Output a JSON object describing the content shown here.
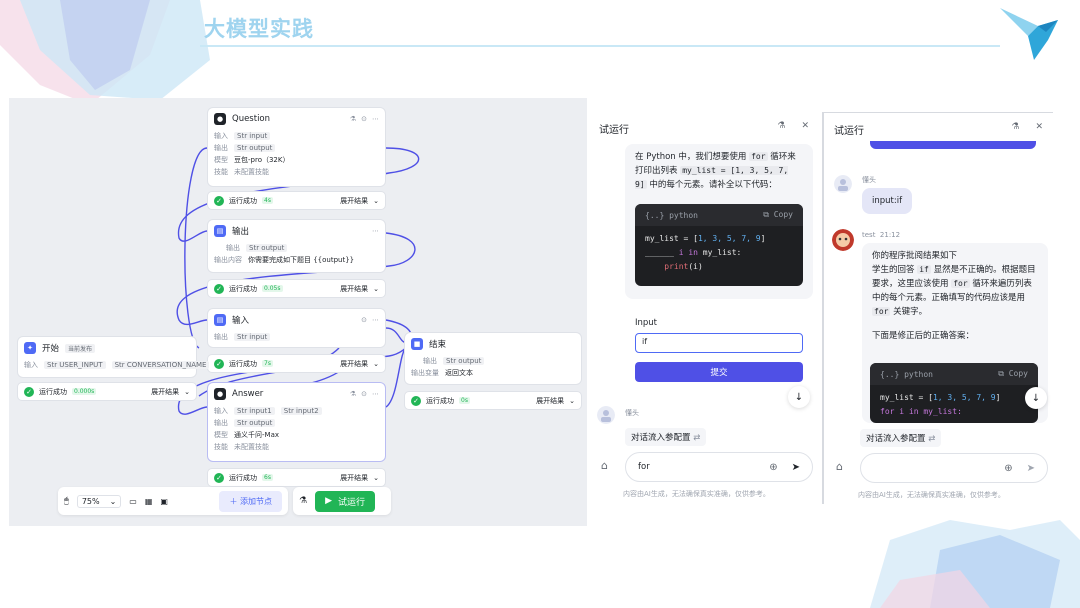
{
  "slide": {
    "title": "大模型实践"
  },
  "canvas": {
    "nodes": {
      "question": {
        "title": "Question",
        "in_label": "输入",
        "in_val": "Str input",
        "out_label": "输出",
        "out_val": "Str output",
        "model_label": "模型",
        "model_val": "豆包-pro（32K）",
        "skill_label": "技能",
        "skill_val": "未配置技能",
        "status": "运行成功",
        "time": "4s",
        "expand": "展开结果"
      },
      "output": {
        "title": "输出",
        "out_label": "输出",
        "out_val": "Str output",
        "content_label": "输出内容",
        "content_val": "你需要完成如下题目 {{output}}",
        "status": "运行成功",
        "time": "0.05s",
        "expand": "展开结果"
      },
      "input": {
        "title": "输入",
        "out_label": "输出",
        "out_val": "Str input",
        "status": "运行成功",
        "time": "7s",
        "expand": "展开结果"
      },
      "start": {
        "title": "开始",
        "badge": "当前发布",
        "in_label": "输入",
        "v1": "Str USER_INPUT",
        "v2": "Str CONVERSATION_NAME",
        "status": "运行成功",
        "time": "0.000s",
        "expand": "展开结果"
      },
      "answer": {
        "title": "Answer",
        "in_label": "输入",
        "in1": "Str input1",
        "in2": "Str input2",
        "out_label": "输出",
        "out_val": "Str output",
        "model_label": "模型",
        "model_val": "通义千问-Max",
        "skill_label": "技能",
        "skill_val": "未配置技能",
        "status": "运行成功",
        "time": "6s",
        "expand": "展开结果"
      },
      "end": {
        "title": "结束",
        "out_label": "输出",
        "out_val": "Str output",
        "content_label": "输出变量",
        "content_val": "返回文本",
        "status": "运行成功",
        "time": "0s",
        "expand": "展开结果"
      }
    },
    "toolbar": {
      "zoom": "75%",
      "add_node": "添加节点",
      "run": "试运行"
    }
  },
  "panel1": {
    "title": "试运行",
    "message": {
      "p1": "在 Python 中，我们想要使用",
      "c1": "for",
      "p2": "循环来打印出列表",
      "c2": "my_list = [1, 3, 5, 7, 9]",
      "p3": "中的每个元素。请补全以下代码："
    },
    "code": {
      "lang": "python",
      "copy": "Copy",
      "line1a": "my_list = [",
      "line1n": "1, 3, 5, 7, 9",
      "line1b": "]",
      "line2a": "______ ",
      "line2k": "i in",
      "line2b": " my_list:",
      "line3": "print",
      "line3b": "(i)"
    },
    "input_label": "Input",
    "input_value": "if",
    "submit": "提交",
    "user_name": "懂头",
    "chip": "对话流入参配置",
    "composer_value": "for",
    "disclaimer": "内容由AI生成，无法确保真实准确，仅供参考。"
  },
  "panel2": {
    "title": "试运行",
    "user_name": "懂头",
    "user_msg": "input:if",
    "bot_name": "test",
    "bot_time": "21:12",
    "reply": {
      "l1": "你的程序批阅结果如下",
      "l2a": "学生的回答",
      "l2c": "if",
      "l2b": "显然是不正确的。根据题目要求，这里应该使用",
      "l2c2": "for",
      "l2d": "循环来遍历列表中的每个元素。正确填写的代码应该是用",
      "l2c3": "for",
      "l2e": "关键字。",
      "l3": "下面是修正后的正确答案："
    },
    "code": {
      "lang": "python",
      "copy": "Copy",
      "line1a": "my_list = [",
      "line1n": "1, 3, 5, 7, 9",
      "line1b": "]",
      "line2": "for i in my_list:"
    },
    "chip": "对话流入参配置",
    "disclaimer": "内容由AI生成，无法确保真实准确，仅供参考。"
  }
}
